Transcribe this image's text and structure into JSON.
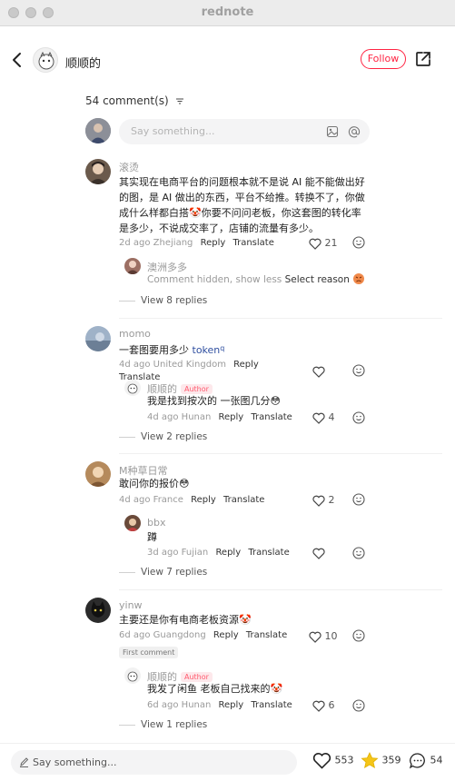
{
  "window": {
    "title": "rednote"
  },
  "header": {
    "author_name": "顺顺的",
    "follow_label": "Follow"
  },
  "comments_header": {
    "count_label": "54 comment(s)"
  },
  "composer": {
    "placeholder": "Say something..."
  },
  "comments": [
    {
      "user": "滚烫",
      "text_lines": [
        "其实现在电商平台的问题根本就不是说 AI 能不能做出好",
        "的图，是 AI 做出的东西，平台不给推。转换不了，你做",
        "成什么样都白搭🤡你要不问问老板，你这套图的转化率",
        "是多少，不说成交率了，店铺的流量有多少。"
      ],
      "time": "2d ago",
      "location": "Zhejiang",
      "reply": "Reply",
      "translate": "Translate",
      "likes": "21",
      "reply_item": {
        "user": "澳洲多多",
        "hidden_text": "Comment hidden, show less",
        "select_reason": "Select reason"
      },
      "view_replies": "View 8 replies"
    },
    {
      "user": "momo",
      "text": "一套图要用多少",
      "link": "token",
      "time": "4d ago",
      "location": "United Kingdom",
      "reply": "Reply",
      "translate": "Translate",
      "reply_item": {
        "user": "顺顺的",
        "tag": "Author",
        "text": "我是找到按次的 一张图几分😳",
        "time": "4d ago",
        "location": "Hunan",
        "reply": "Reply",
        "translate": "Translate",
        "likes": "4"
      },
      "view_replies": "View 2 replies"
    },
    {
      "user": "M种草日常",
      "text": "敢问你的报价😳",
      "time": "4d ago",
      "location": "France",
      "reply": "Reply",
      "translate": "Translate",
      "likes": "2",
      "reply_item": {
        "user": "bbx",
        "text": "蹲",
        "time": "3d ago",
        "location": "Fujian",
        "reply": "Reply",
        "translate": "Translate"
      },
      "view_replies": "View 7 replies"
    },
    {
      "user": "yinw",
      "text": "主要还是你有电商老板资源🤡",
      "time": "6d ago",
      "location": "Guangdong",
      "reply": "Reply",
      "translate": "Translate",
      "likes": "10",
      "tag": "First comment",
      "reply_item": {
        "user": "顺顺的",
        "tag": "Author",
        "text": "我发了闲鱼 老板自己找来的🤡",
        "time": "6d ago",
        "location": "Hunan",
        "reply": "Reply",
        "translate": "Translate",
        "likes": "6"
      },
      "view_replies": "View 1 replies"
    }
  ],
  "bottom_bar": {
    "placeholder": "Say something...",
    "likes": "553",
    "collects": "359",
    "comments": "54"
  },
  "colors": {
    "accent": "#ff2442",
    "star": "#f5c518"
  }
}
